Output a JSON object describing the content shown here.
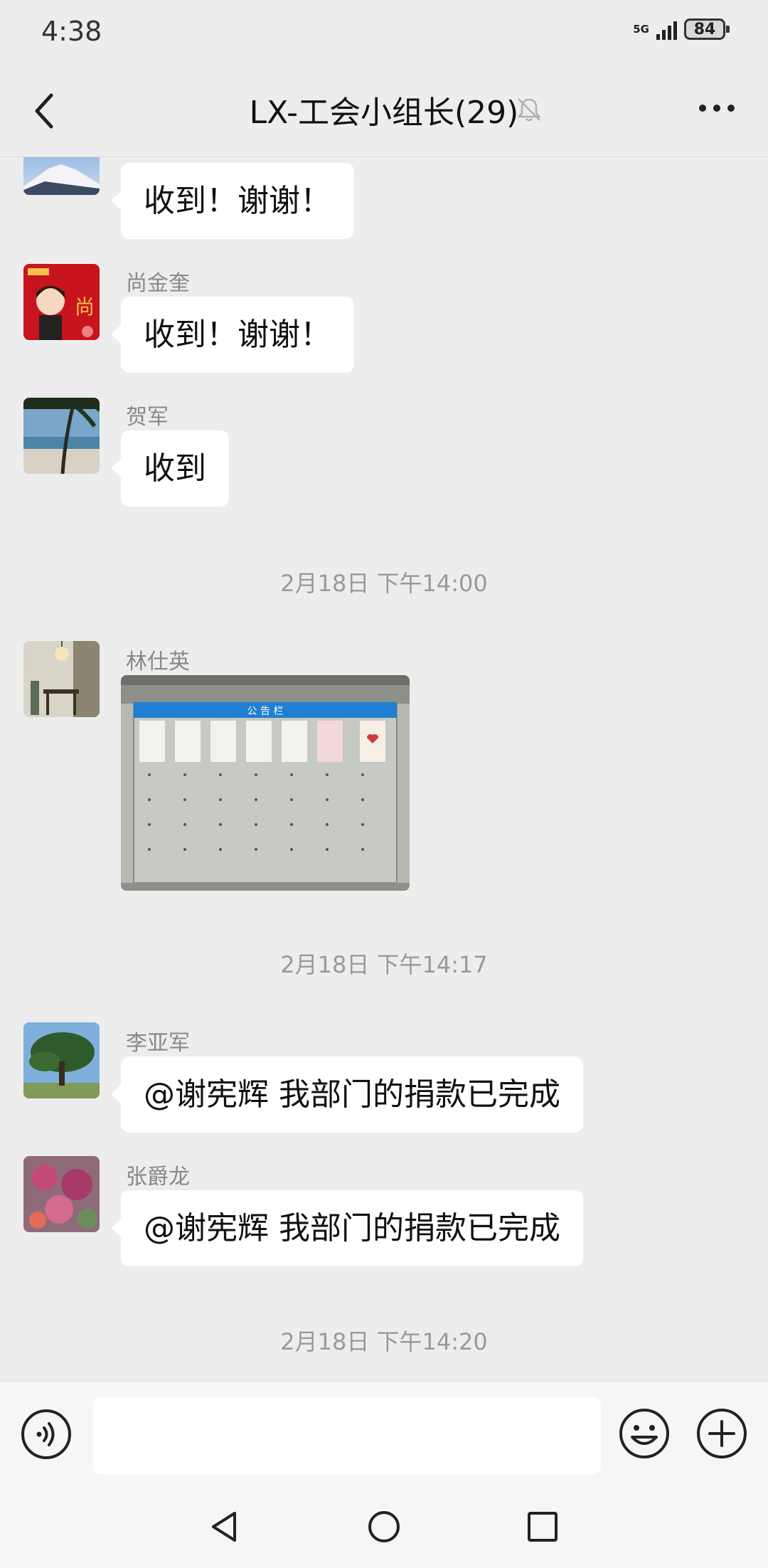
{
  "status_bar": {
    "time": "4:38",
    "network": "5G",
    "battery": "84"
  },
  "header": {
    "title": "LX-工会小组长(29)",
    "back_icon": "chevron-left-icon",
    "mute_icon": "bell-off-icon",
    "more_icon": "more-horizontal-icon"
  },
  "messages": [
    {
      "sender": "",
      "text": "收到！谢谢！",
      "avatar": "snow-mountain-avatar"
    },
    {
      "sender": "尚金奎",
      "text": "收到！谢谢！",
      "avatar": "cartoon-new-year-avatar"
    },
    {
      "sender": "贺军",
      "text": "收到",
      "avatar": "beach-palm-avatar"
    },
    {
      "timestamp": "2月18日 下午14:00"
    },
    {
      "sender": "林仕英",
      "image": "bulletin-board-photo",
      "board_title": "公 告 栏",
      "avatar": "interior-lamp-avatar"
    },
    {
      "timestamp": "2月18日 下午14:17"
    },
    {
      "sender": "李亚军",
      "text": "@谢宪辉  我部门的捐款已完成",
      "avatar": "tree-avatar"
    },
    {
      "sender": "张爵龙",
      "text": "@谢宪辉  我部门的捐款已完成",
      "avatar": "flowers-avatar"
    },
    {
      "timestamp": "2月18日 下午14:20"
    }
  ],
  "input_bar": {
    "voice_icon": "voice-icon",
    "input_value": "",
    "emoji_icon": "emoji-icon",
    "plus_icon": "plus-circle-icon"
  },
  "system_nav": {
    "back": "triangle-back-icon",
    "home": "circle-home-icon",
    "recents": "square-recents-icon"
  },
  "colors": {
    "background": "#ededed",
    "bubble": "#ffffff",
    "timestamp": "#9a9a9a"
  }
}
